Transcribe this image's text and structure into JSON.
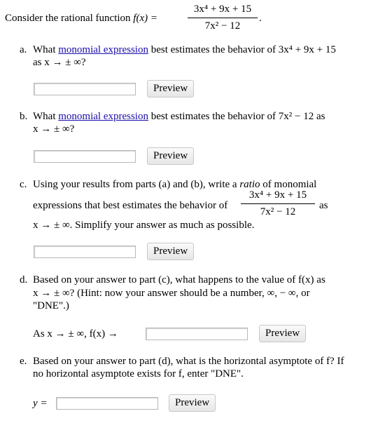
{
  "intro": {
    "text": "Consider the rational function",
    "func": "f(x) =",
    "numerator": "3x⁴ + 9x + 15",
    "denominator": "7x² − 12",
    "end": "."
  },
  "parts": {
    "a": {
      "label": "a.",
      "pre": "What",
      "link": "monomial expression",
      "post": "best estimates the behavior of 3x⁴ + 9x + 15",
      "line2": "as x → ± ∞?",
      "button": "Preview"
    },
    "b": {
      "label": "b.",
      "pre": "What",
      "link": "monomial expression",
      "post": "best estimates the behavior of 7x² − 12 as",
      "line2": "x → ± ∞?",
      "button": "Preview"
    },
    "c": {
      "label": "c.",
      "line1_a": "Using your results from parts (a) and (b), write a",
      "line1_em": "ratio",
      "line1_b": "of monomial",
      "line2": "expressions that best estimates the behavior of",
      "numerator": "3x⁴ + 9x + 15",
      "denominator": "7x² − 12",
      "line2_end": "as",
      "line3": "x → ± ∞. Simplify your answer as much as possible.",
      "button": "Preview"
    },
    "d": {
      "label": "d.",
      "line1": "Based on your answer to part (c), what happens to the value of f(x) as",
      "line2": "x → ± ∞? (Hint: now your answer should be a number, ∞, − ∞, or",
      "line3": "\"DNE\".)",
      "prompt": "As x → ± ∞, f(x) →",
      "button": "Preview"
    },
    "e": {
      "label": "e.",
      "line1": "Based on your answer to part (d), what is the horizontal asymptote of f? If",
      "line2": "no horizontal asymptote exists for f, enter \"DNE\".",
      "prompt": "y =",
      "button": "Preview"
    }
  }
}
